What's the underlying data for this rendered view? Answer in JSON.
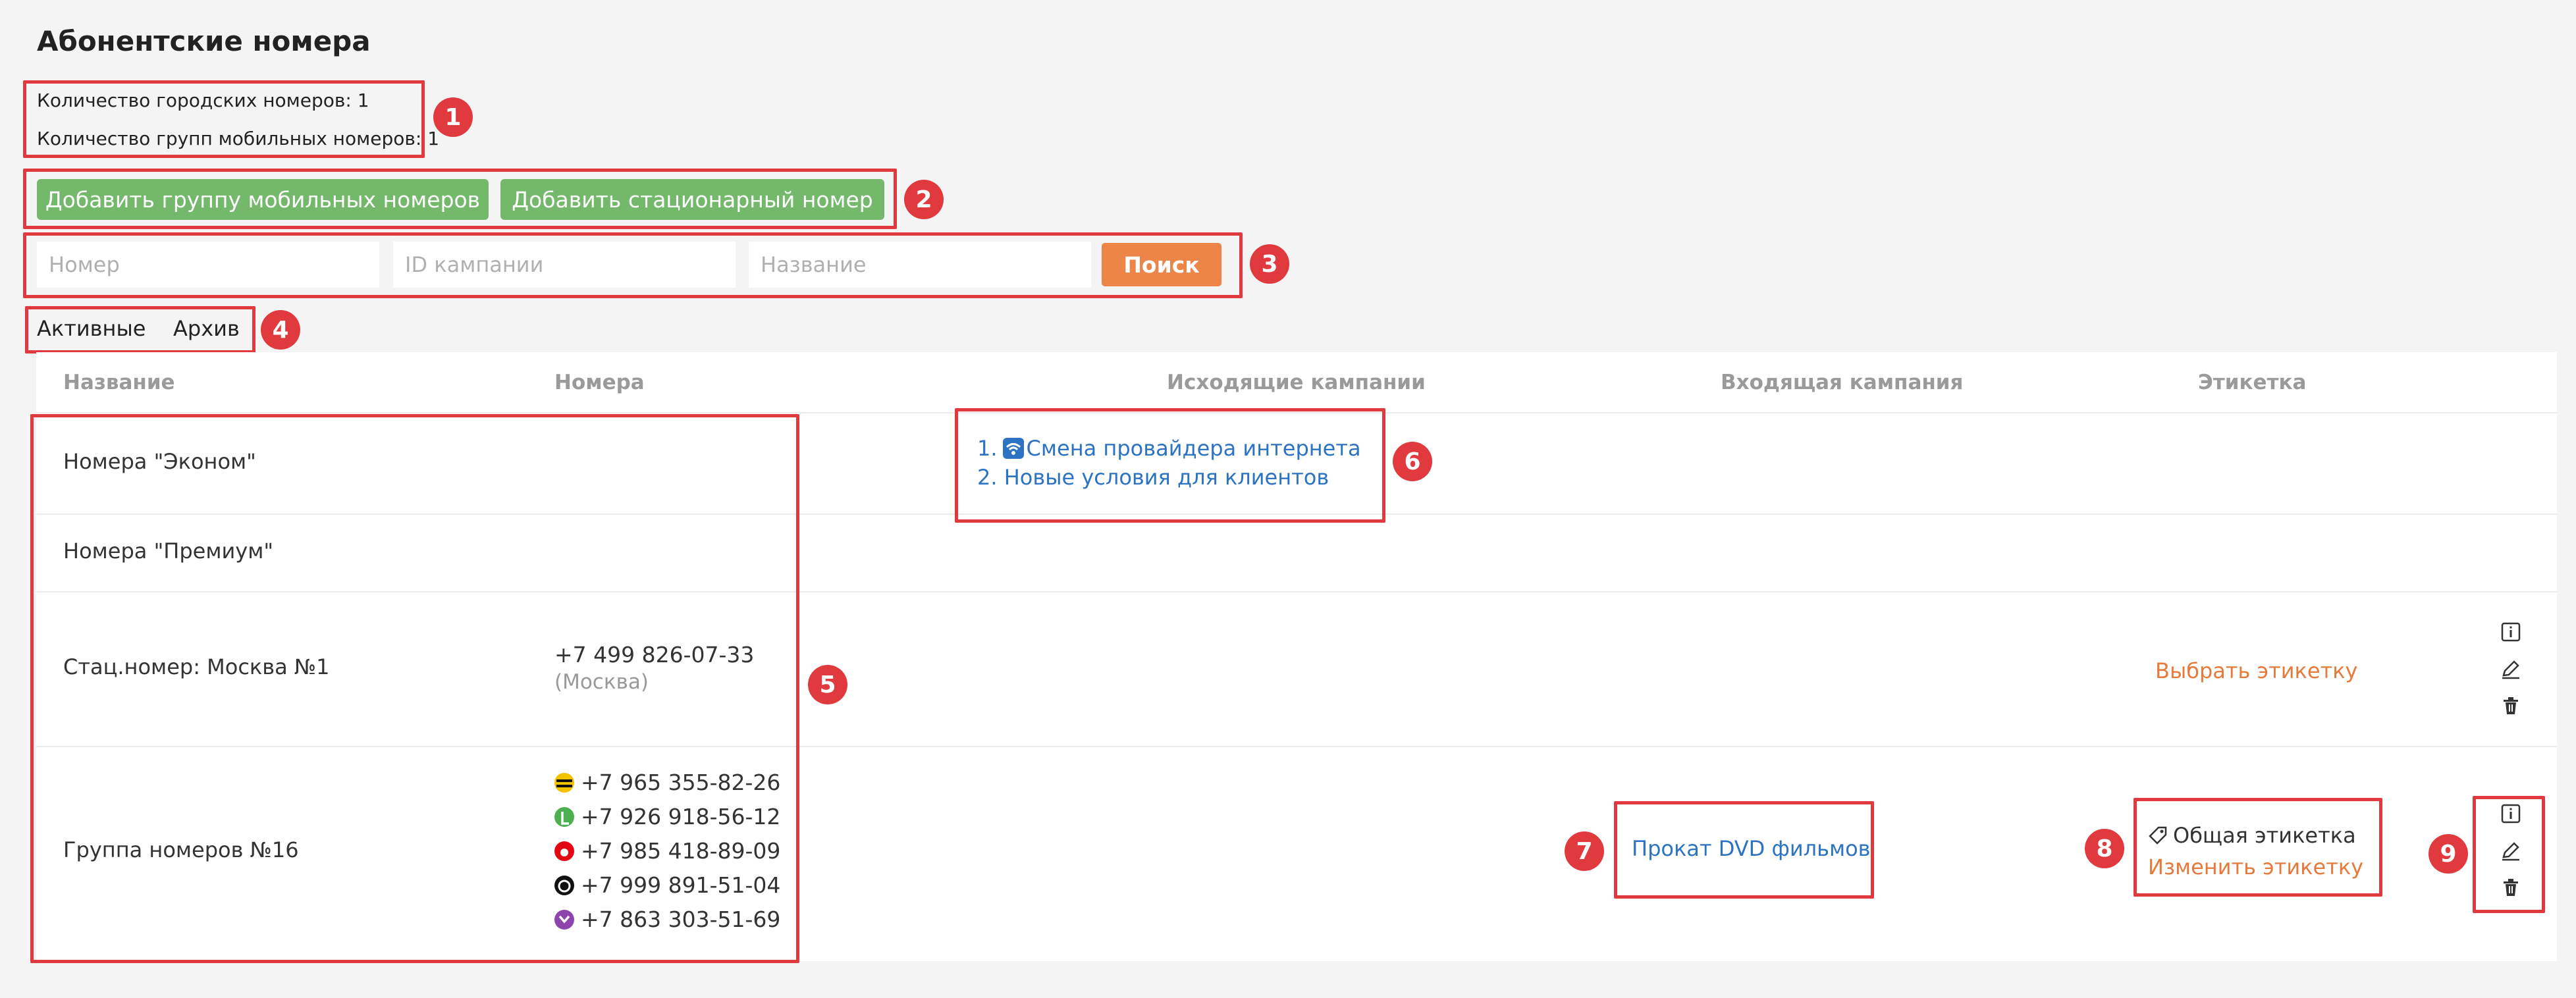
{
  "page": {
    "title": "Абонентские номера"
  },
  "summary": {
    "city_numbers": "Количество городских номеров: 1",
    "mobile_groups": "Количество групп мобильных номеров: 1"
  },
  "actions": {
    "add_mobile_group": "Добавить группу мобильных номеров",
    "add_fixed_number": "Добавить стационарный номер"
  },
  "search": {
    "number_placeholder": "Номер",
    "campaign_id_placeholder": "ID кампании",
    "name_placeholder": "Название",
    "button": "Поиск"
  },
  "tabs": [
    {
      "label": "Активные"
    },
    {
      "label": "Архив"
    }
  ],
  "table": {
    "columns": [
      "Название",
      "Номера",
      "Исходящие кампании",
      "Входящая кампания",
      "Этикетка"
    ],
    "rows": [
      {
        "name": "Номера \"Эконом\"",
        "outgoing": [
          {
            "index": "1.",
            "text": "Смена провайдера интернета",
            "icon": "wifi-icon"
          },
          {
            "index": "2.",
            "text": "Новые условия для клиентов"
          }
        ]
      },
      {
        "name": "Номера \"Премиум\""
      },
      {
        "name": "Стац.номер: Москва №1",
        "number": "+7 499 826-07-33",
        "number_city": "(Москва)",
        "label_action": "Выбрать этикетку"
      },
      {
        "name": "Группа номеров №16",
        "numbers": [
          {
            "value": "+7 965 355-82-26",
            "operator_icon": "beeline-icon",
            "color": "#f2c200"
          },
          {
            "value": "+7 926 918-56-12",
            "operator_icon": "megafon-icon",
            "color": "#4caf50"
          },
          {
            "value": "+7 985 418-89-09",
            "operator_icon": "mts-icon",
            "color": "#e30613"
          },
          {
            "value": "+7 999 891-51-04",
            "operator_icon": "tele2-icon",
            "color": "#111111"
          },
          {
            "value": "+7 863 303-51-69",
            "operator_icon": "yota-icon",
            "color": "#8e44ad"
          }
        ],
        "incoming": "Прокат DVD фильмов",
        "label": "Общая этикетка",
        "label_action": "Изменить этикетку"
      }
    ]
  },
  "callouts": [
    "1",
    "2",
    "3",
    "4",
    "5",
    "6",
    "7",
    "8",
    "9"
  ],
  "colors": {
    "accent_green": "#73b86b",
    "accent_orange": "#ee8548",
    "link_blue": "#2c73c3",
    "callout_red": "#e0393e"
  }
}
